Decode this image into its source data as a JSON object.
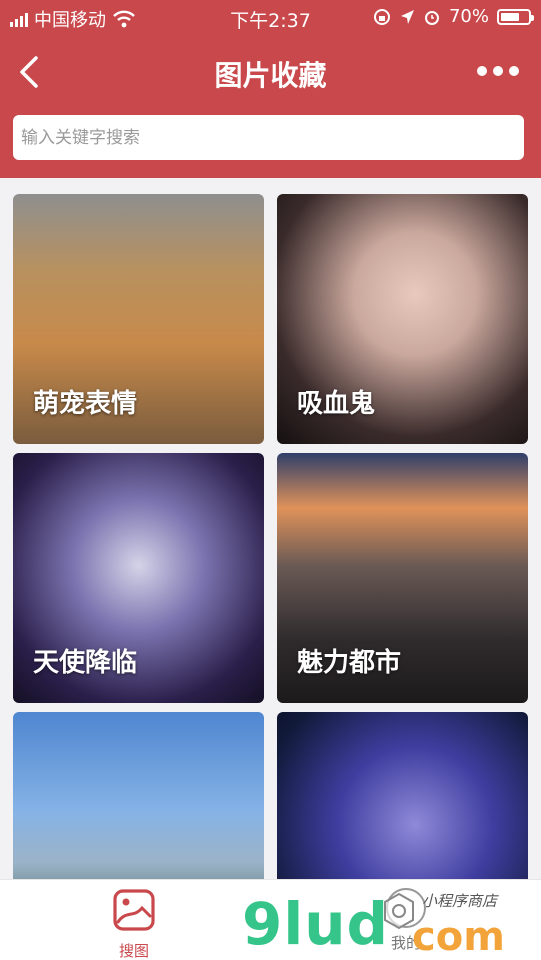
{
  "status_bar": {
    "carrier": "中国移动",
    "time": "下午2:37",
    "battery": "70%",
    "battery_level": 0.7
  },
  "navbar": {
    "title": "图片收藏",
    "back_icon": "chevron-left-icon",
    "more_icon": "more-dots-icon"
  },
  "search": {
    "placeholder": "输入关键字搜索",
    "value": ""
  },
  "categories": [
    {
      "label": "萌宠表情"
    },
    {
      "label": "吸血鬼"
    },
    {
      "label": "天使降临"
    },
    {
      "label": "魅力都市"
    },
    {
      "label": ""
    },
    {
      "label": ""
    }
  ],
  "tabbar": {
    "items": [
      {
        "label": "搜图",
        "icon": "image-icon",
        "active": true
      },
      {
        "label": "我的",
        "icon": "user-icon",
        "active": false
      }
    ]
  },
  "watermark": {
    "brand": "9lud",
    "domain": "com",
    "text": "小程序商店"
  },
  "colors": {
    "primary": "#c9484b",
    "background": "#f2f2f4",
    "tab_active": "#c9484b"
  }
}
